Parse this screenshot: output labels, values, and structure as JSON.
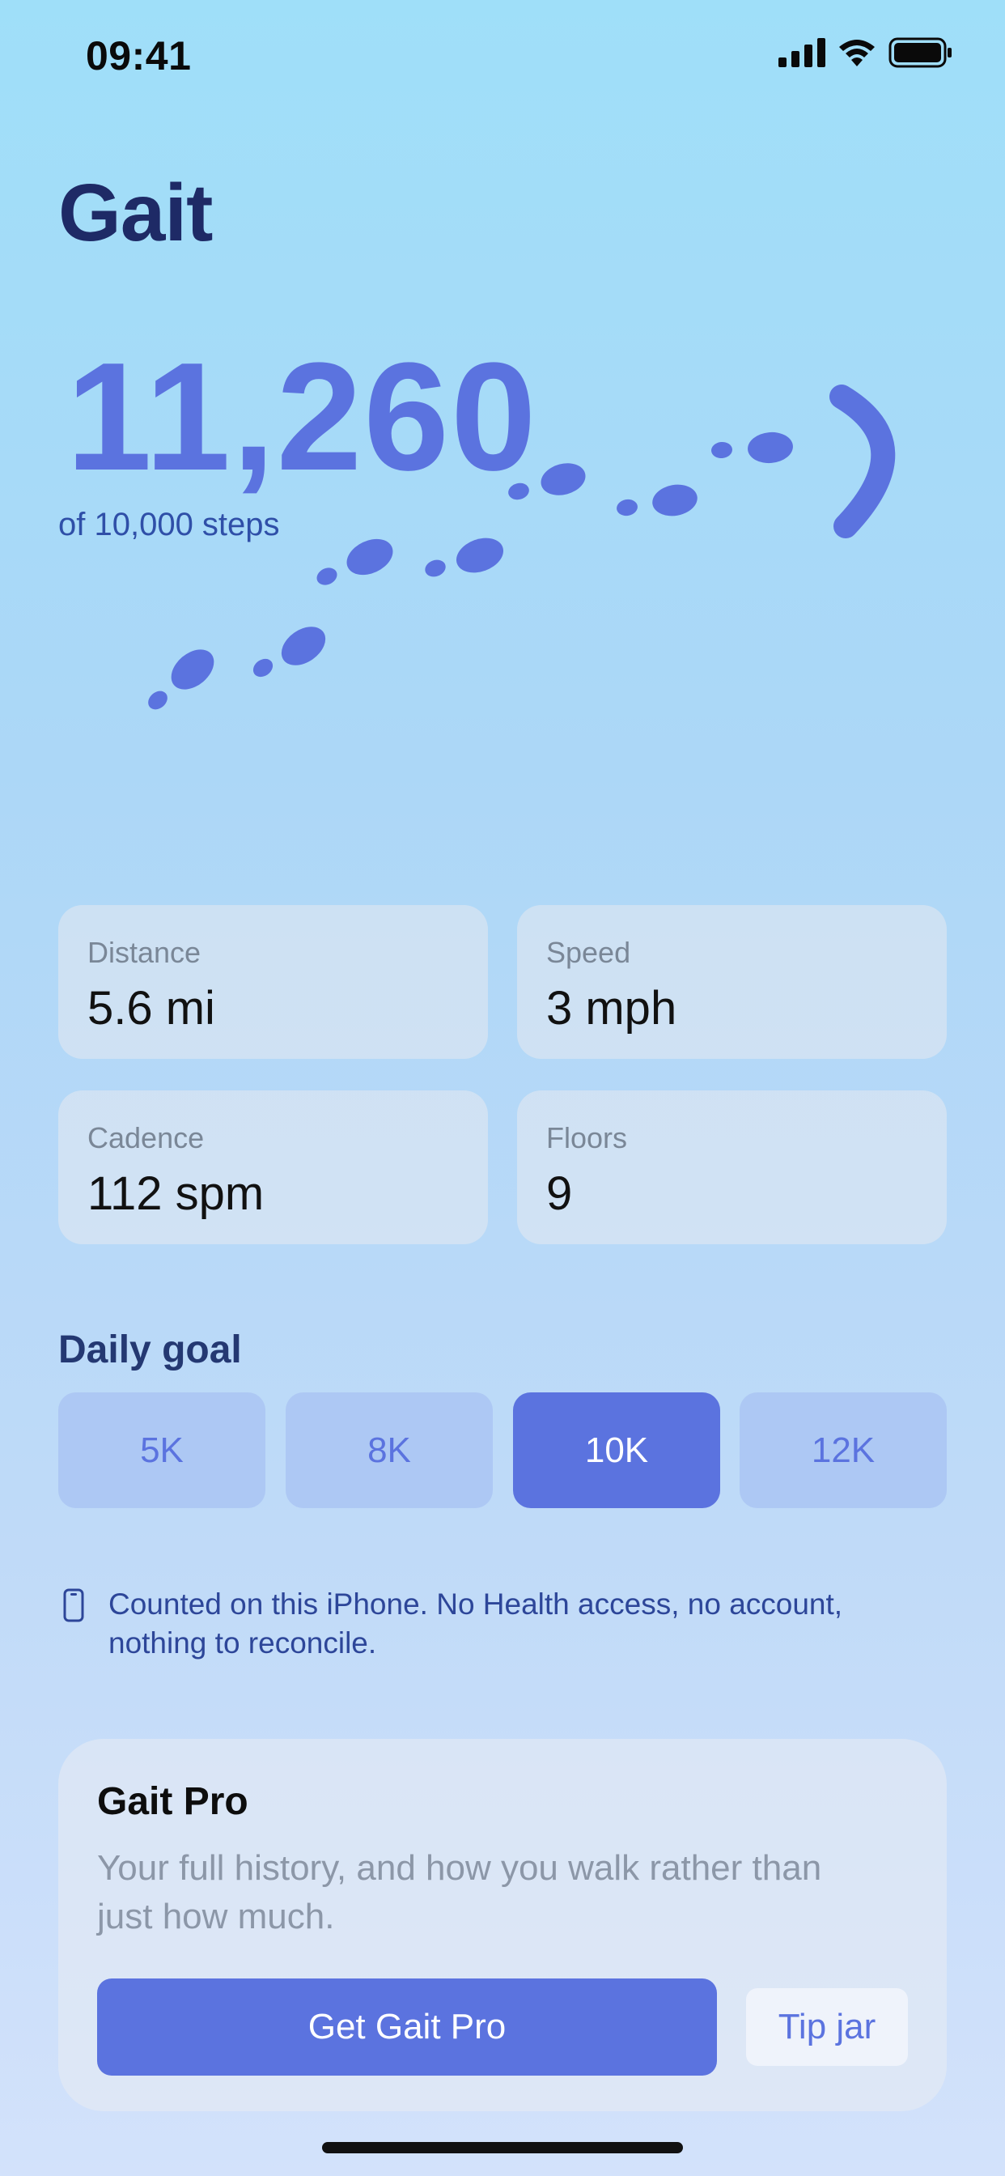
{
  "status_bar": {
    "time": "09:41"
  },
  "app": {
    "title": "Gait"
  },
  "steps": {
    "count": "11,260",
    "goal_text": "of 10,000 steps",
    "progress_fraction": 1.126
  },
  "stats": [
    {
      "label": "Distance",
      "value": "5.6 mi"
    },
    {
      "label": "Speed",
      "value": "3 mph"
    },
    {
      "label": "Cadence",
      "value": "112 spm"
    },
    {
      "label": "Floors",
      "value": "9"
    }
  ],
  "daily_goal": {
    "title": "Daily goal",
    "options": [
      "5K",
      "8K",
      "10K",
      "12K"
    ],
    "selected": "10K"
  },
  "privacy": {
    "icon": "phone-icon",
    "note": "Counted on this iPhone. No Health access, no account, nothing to reconcile."
  },
  "pro": {
    "title": "Gait Pro",
    "description": "Your full history, and how you walk rather than just how much.",
    "cta_label": "Get Gait Pro",
    "tip_label": "Tip jar"
  },
  "colors": {
    "accent": "#5b73df",
    "title": "#1e2a66",
    "goal_unselected": "#adc8f4"
  }
}
